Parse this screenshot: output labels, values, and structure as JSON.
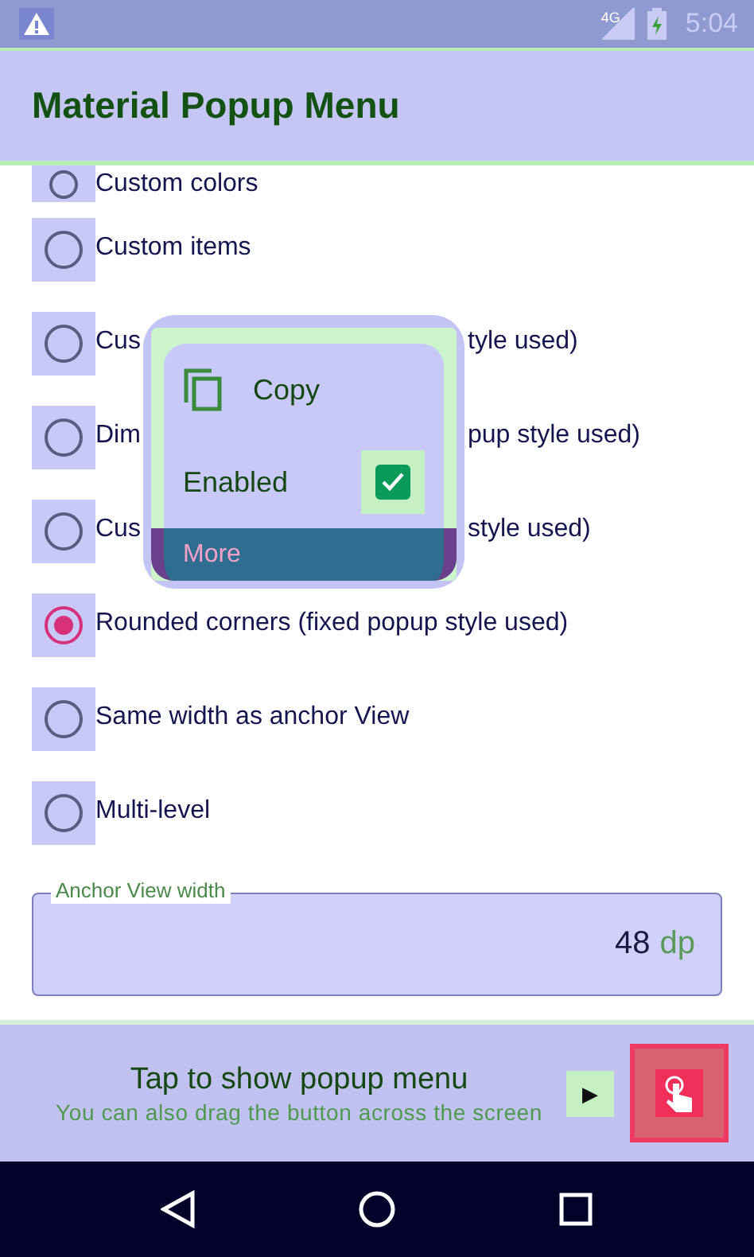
{
  "status_bar": {
    "time": "5:04",
    "network": "4G"
  },
  "app_bar": {
    "title": "Material Popup Menu"
  },
  "options": [
    {
      "label": "Custom colors",
      "selected": false
    },
    {
      "label": "Custom items",
      "selected": false
    },
    {
      "label": "Cus",
      "label_end": "tyle used)",
      "selected": false
    },
    {
      "label": "Dim",
      "label_end": "pup style used)",
      "selected": false
    },
    {
      "label": "Cus",
      "label_end": "style used)",
      "selected": false
    },
    {
      "label": "Rounded corners (fixed popup style used)",
      "selected": true
    },
    {
      "label": "Same width as anchor View",
      "selected": false
    },
    {
      "label": "Multi-level",
      "selected": false
    }
  ],
  "anchor_width": {
    "label": "Anchor View width",
    "value": "48",
    "suffix": "dp"
  },
  "popup": {
    "items": [
      {
        "kind": "icon",
        "label": "Copy"
      },
      {
        "kind": "checkbox",
        "label": "Enabled",
        "checked": true
      },
      {
        "kind": "submenu",
        "label": "More"
      }
    ]
  },
  "bottom_bar": {
    "title": "Tap to show popup menu",
    "subtitle": "You can also drag the button across the screen",
    "arrow": "▶"
  }
}
